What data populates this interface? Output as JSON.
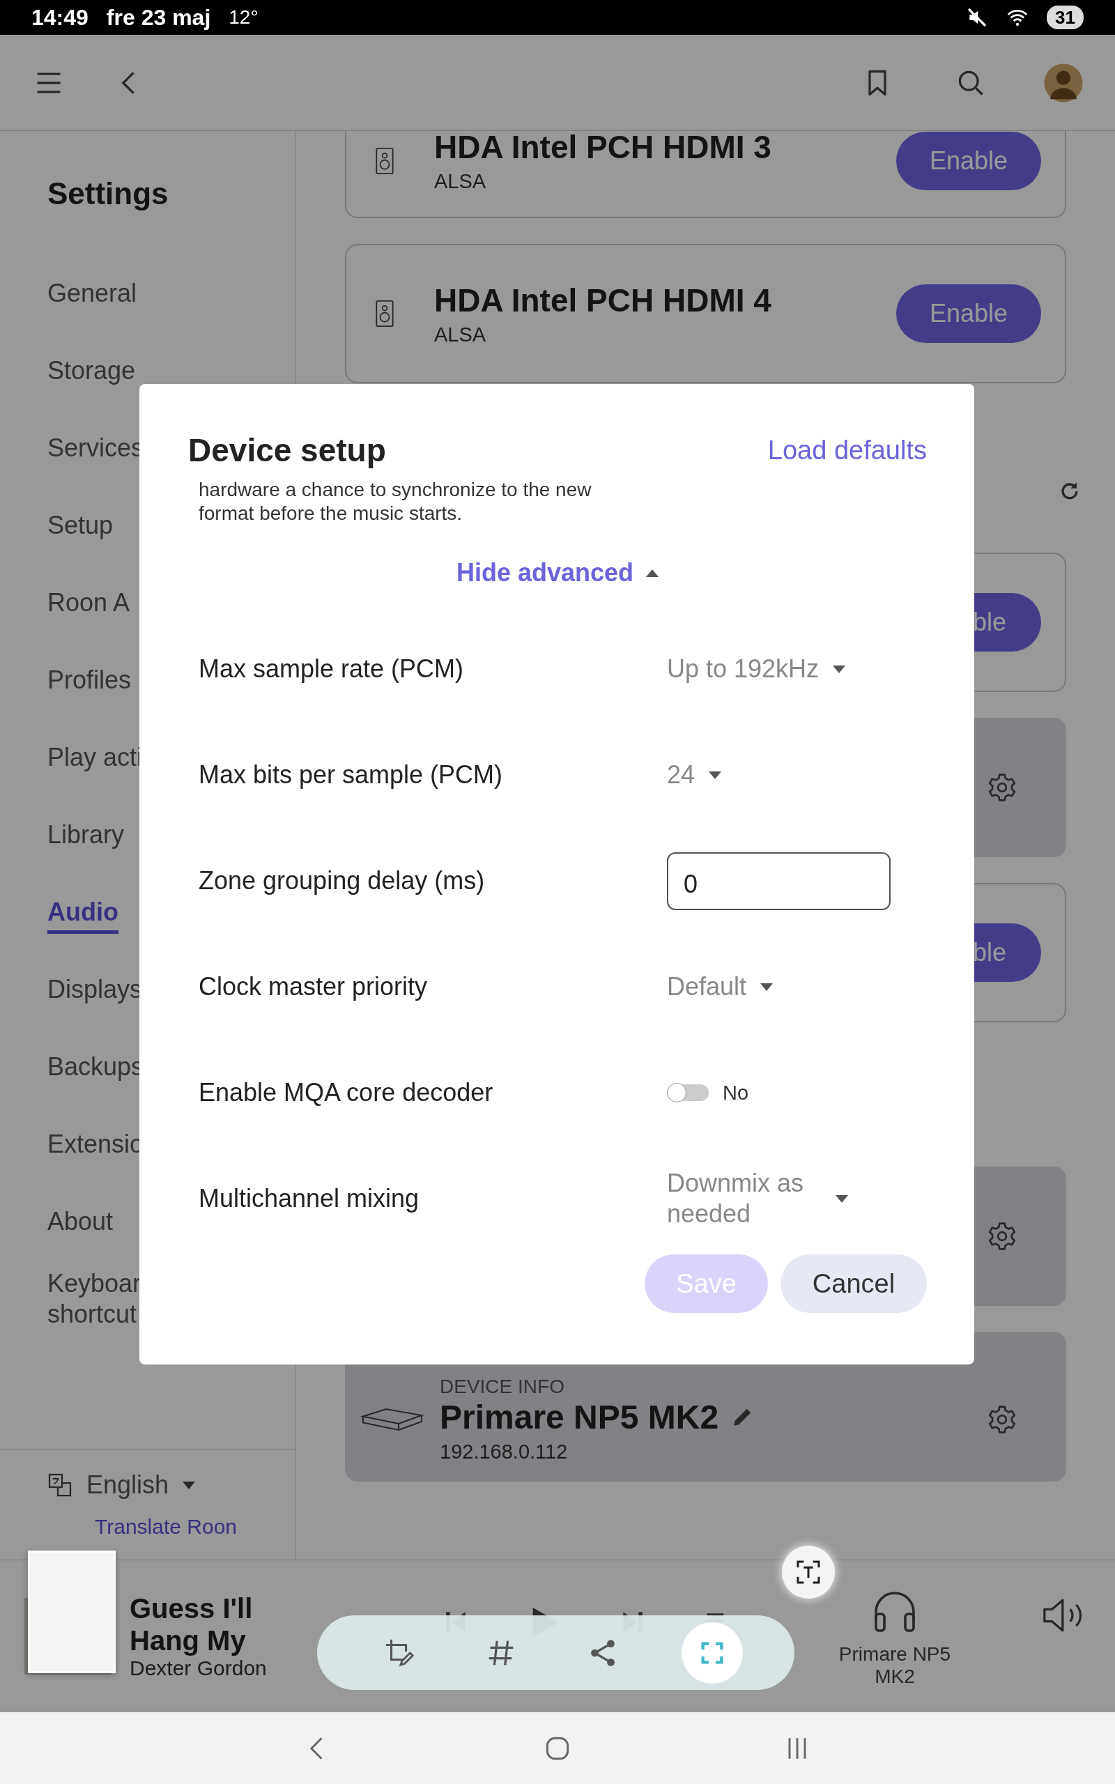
{
  "status_bar": {
    "time": "14:49",
    "date": "fre 23 maj",
    "temperature": "12°",
    "battery": "31"
  },
  "sidebar": {
    "title": "Settings",
    "items": [
      {
        "label": "General",
        "selected": false
      },
      {
        "label": "Storage",
        "selected": false
      },
      {
        "label": "Services",
        "selected": false
      },
      {
        "label": "Setup",
        "selected": false
      },
      {
        "label": "Roon A",
        "selected": false
      },
      {
        "label": "Profiles",
        "selected": false
      },
      {
        "label": "Play acti",
        "selected": false
      },
      {
        "label": "Library",
        "selected": false
      },
      {
        "label": "Audio",
        "selected": true
      },
      {
        "label": "Displays",
        "selected": false
      },
      {
        "label": "Backups",
        "selected": false
      },
      {
        "label": "Extensio",
        "selected": false
      },
      {
        "label": "About",
        "selected": false
      },
      {
        "label": "Keyboar shortcut",
        "selected": false
      }
    ],
    "language": "English",
    "translate_link": "Translate Roon"
  },
  "cards": [
    {
      "kind": "output",
      "name": "HDA Intel PCH HDMI 3",
      "driver": "ALSA",
      "button": "Enable"
    },
    {
      "kind": "output",
      "name": "HDA Intel PCH HDMI 4",
      "driver": "ALSA",
      "button": "Enable"
    },
    {
      "kind": "section",
      "refresh": true
    },
    {
      "kind": "partial_output",
      "button": "ble"
    },
    {
      "kind": "configured"
    },
    {
      "kind": "partial_output",
      "button": "ble"
    },
    {
      "kind": "section",
      "refresh": false
    },
    {
      "kind": "configured"
    },
    {
      "kind": "device_info",
      "heading": "DEVICE INFO",
      "name": "Primare NP5 MK2",
      "address": "192.168.0.112"
    }
  ],
  "dialog": {
    "title": "Device setup",
    "load_defaults": "Load defaults",
    "note": "hardware a chance to synchronize to the new format before the music starts.",
    "advanced_toggle": {
      "label": "Hide advanced",
      "expanded": true
    },
    "settings": [
      {
        "kind": "dropdown",
        "label": "Max sample rate (PCM)",
        "value": "Up to 192kHz"
      },
      {
        "kind": "dropdown",
        "label": "Max bits per sample (PCM)",
        "value": "24"
      },
      {
        "kind": "input",
        "label": "Zone grouping delay (ms)",
        "value": "0"
      },
      {
        "kind": "dropdown",
        "label": "Clock master priority",
        "value": "Default"
      },
      {
        "kind": "toggle",
        "label": "Enable MQA core decoder",
        "on": false,
        "value": "No"
      },
      {
        "kind": "dropdown",
        "label": "Multichannel mixing",
        "value": "Downmix as needed"
      }
    ],
    "save": {
      "label": "Save",
      "disabled": true
    },
    "cancel": {
      "label": "Cancel"
    }
  },
  "player": {
    "title_line_1": "Guess I'll",
    "title_line_2": "Hang My",
    "artist": "Dexter Gordon",
    "zone": "Primare NP5 MK2"
  }
}
